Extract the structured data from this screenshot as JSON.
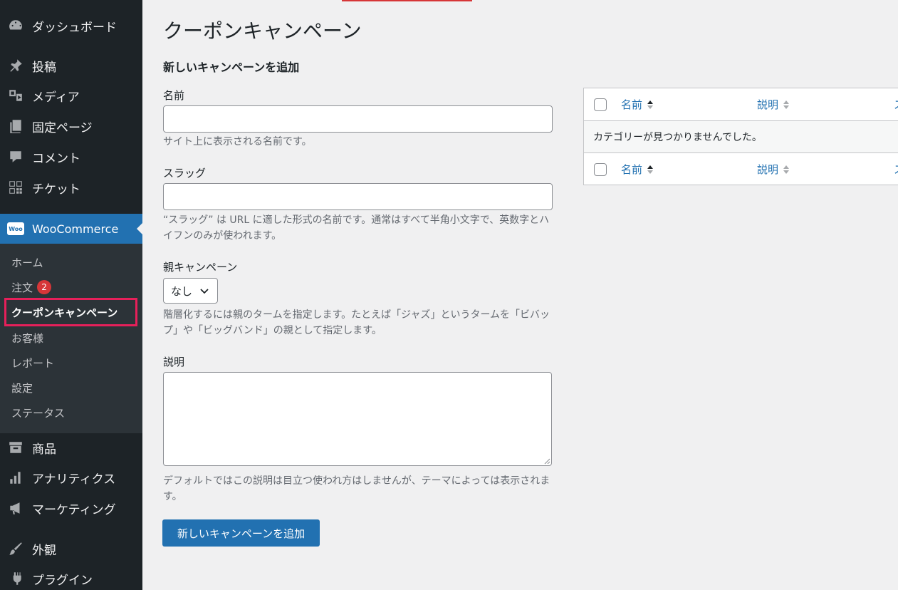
{
  "sidebar": {
    "items": [
      {
        "label": "ダッシュボード",
        "icon": "dashboard-icon"
      },
      {
        "label": "投稿",
        "icon": "pin-icon"
      },
      {
        "label": "メディア",
        "icon": "media-icon"
      },
      {
        "label": "固定ページ",
        "icon": "page-icon"
      },
      {
        "label": "コメント",
        "icon": "comment-icon"
      },
      {
        "label": "チケット",
        "icon": "ticket-icon"
      }
    ],
    "woocommerce": {
      "label": "WooCommerce",
      "logo_text": "Woo"
    },
    "submenu": [
      {
        "label": "ホーム"
      },
      {
        "label": "注文",
        "badge": "2"
      },
      {
        "label": "クーポンキャンペーン"
      },
      {
        "label": "お客様"
      },
      {
        "label": "レポート"
      },
      {
        "label": "設定"
      },
      {
        "label": "ステータス"
      }
    ],
    "items_after": [
      {
        "label": "商品",
        "icon": "archive-icon"
      },
      {
        "label": "アナリティクス",
        "icon": "chart-icon"
      },
      {
        "label": "マーケティング",
        "icon": "megaphone-icon"
      },
      {
        "label": "外観",
        "icon": "brush-icon"
      },
      {
        "label": "プラグイン",
        "icon": "plugin-icon"
      }
    ]
  },
  "colors": {
    "accent": "#2271b1",
    "sidebar": "#1d2327",
    "highlight": "#e6205a"
  },
  "page": {
    "title": "クーポンキャンペーン"
  },
  "form": {
    "heading": "新しいキャンペーンを追加",
    "name": {
      "label": "名前",
      "value": "",
      "help": "サイト上に表示される名前です。"
    },
    "slug": {
      "label": "スラッグ",
      "value": "",
      "help": "“スラッグ” は URL に適した形式の名前です。通常はすべて半角小文字で、英数字とハイフンのみが使われます。"
    },
    "parent": {
      "label": "親キャンペーン",
      "selected": "なし",
      "help": "階層化するには親のタームを指定します。たとえば「ジャズ」というタームを「ビバップ」や「ビッグバンド」の親として指定します。"
    },
    "description": {
      "label": "説明",
      "value": "",
      "help": "デフォルトではこの説明は目立つ使われ方はしませんが、テーマによっては表示されます。"
    },
    "submit_label": "新しいキャンペーンを追加"
  },
  "table": {
    "columns": [
      {
        "label": "名前"
      },
      {
        "label": "説明"
      },
      {
        "label": "ス"
      }
    ],
    "empty_message": "カテゴリーが見つかりませんでした。"
  }
}
